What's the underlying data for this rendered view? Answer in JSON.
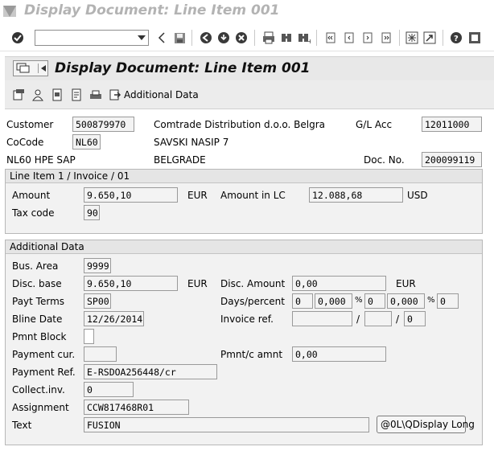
{
  "window": {
    "title": "Display Document: Line Item 001"
  },
  "screen": {
    "title": "Display Document: Line Item 001",
    "app_toolbar": {
      "additional_data_label": "Additional Data"
    }
  },
  "header": {
    "customer_label": "Customer",
    "customer_value": "500879970",
    "customer_name": "Comtrade Distribution d.o.o. Belgra",
    "gl_acc_label": "G/L Acc",
    "gl_acc_value": "12011000",
    "cocode_label": "CoCode",
    "cocode_value": "NL60",
    "street": "SAVSKI NASIP 7",
    "company_name": "NL60 HPE SAP",
    "city": "BELGRADE",
    "doc_no_label": "Doc. No.",
    "doc_no_value": "200099119"
  },
  "line_item": {
    "heading": "Line Item 1 / Invoice / 01",
    "amount_label": "Amount",
    "amount_value": "9.650,10",
    "amount_currency": "EUR",
    "amount_lc_label": "Amount in LC",
    "amount_lc_value": "12.088,68",
    "amount_lc_currency": "USD",
    "tax_code_label": "Tax code",
    "tax_code_value": "90"
  },
  "additional": {
    "heading": "Additional Data",
    "bus_area_label": "Bus. Area",
    "bus_area_value": "9999",
    "disc_base_label": "Disc. base",
    "disc_base_value": "9.650,10",
    "disc_base_currency": "EUR",
    "disc_amount_label": "Disc. Amount",
    "disc_amount_value": "0,00",
    "disc_amount_currency": "EUR",
    "payt_terms_label": "Payt Terms",
    "payt_terms_value": "SP00",
    "days_percent_label": "Days/percent",
    "days1": "0",
    "pct1": "0,000",
    "days2": "0",
    "pct2": "0,000",
    "days3": "0",
    "pct_sign": "%",
    "bline_date_label": "Bline Date",
    "bline_date_value": "12/26/2014",
    "invoice_ref_label": "Invoice ref.",
    "invoice_ref_value": "",
    "invoice_ref_year": "",
    "invoice_ref_item": "0",
    "slash": "/",
    "pmnt_block_label": "Pmnt Block",
    "payment_cur_label": "Payment cur.",
    "payment_cur_value": "",
    "pmnt_c_amnt_label": "Pmnt/c amnt",
    "pmnt_c_amnt_value": "0,00",
    "payment_ref_label": "Payment Ref.",
    "payment_ref_value": "E-RSDOA256448/cr",
    "collect_inv_label": "Collect.inv.",
    "collect_inv_value": "0",
    "assignment_label": "Assignment",
    "assignment_value": "CCW817468R01",
    "text_label": "Text",
    "text_value": "FUSION",
    "display_long_button": "@0L\\QDisplay Long"
  }
}
